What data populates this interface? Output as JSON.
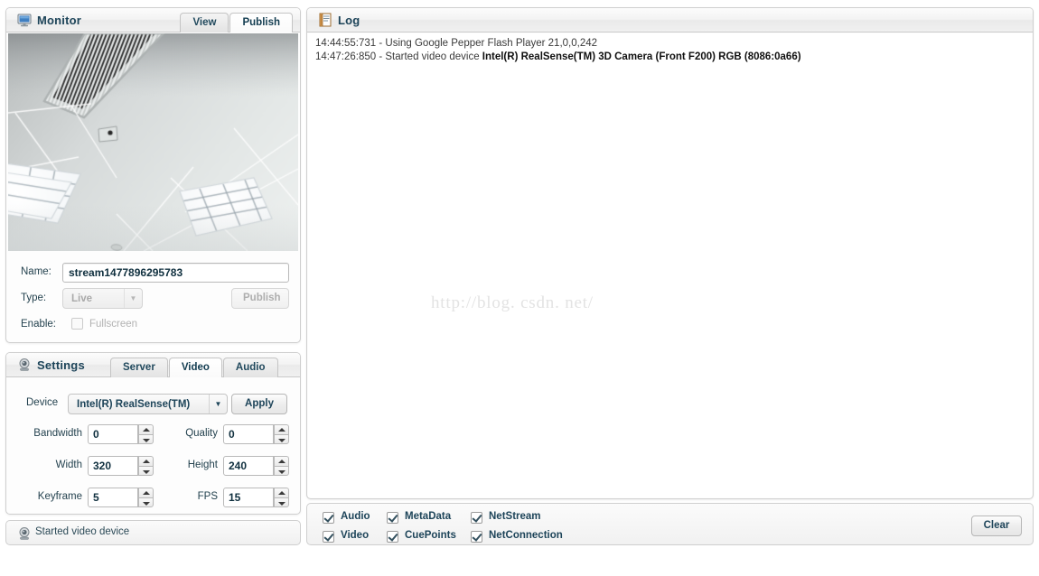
{
  "monitor": {
    "title": "Monitor",
    "icon": "monitor-screen-icon",
    "tabs": [
      {
        "label": "View",
        "active": false
      },
      {
        "label": "Publish",
        "active": true
      }
    ],
    "name_label": "Name:",
    "name_value": "stream1477896295783",
    "type_label": "Type:",
    "type_value": "Live",
    "publish_button": "Publish",
    "enable_label": "Enable:",
    "fullscreen_label": "Fullscreen",
    "fullscreen_checked": false
  },
  "settings": {
    "title": "Settings",
    "icon": "webcam-icon",
    "tabs": [
      {
        "label": "Server",
        "active": false
      },
      {
        "label": "Video",
        "active": true
      },
      {
        "label": "Audio",
        "active": false
      }
    ],
    "device_label": "Device",
    "device_value": "Intel(R) RealSense(TM)",
    "apply_button": "Apply",
    "fields": [
      {
        "label": "Bandwidth",
        "value": "0"
      },
      {
        "label": "Quality",
        "value": "0"
      },
      {
        "label": "Width",
        "value": "320"
      },
      {
        "label": "Height",
        "value": "240"
      },
      {
        "label": "Keyframe",
        "value": "5"
      },
      {
        "label": "FPS",
        "value": "15"
      }
    ]
  },
  "status": {
    "icon": "webcam-icon",
    "text": "Started video device"
  },
  "log": {
    "title": "Log",
    "icon": "notepad-icon",
    "watermark": "http://blog. csdn. net/",
    "lines": [
      {
        "time": "14:44:55:731",
        "sep": " - ",
        "text": "Using Google Pepper Flash Player 21,0,0,242",
        "bold": ""
      },
      {
        "time": "14:47:26:850",
        "sep": " - ",
        "text": "Started video device ",
        "bold": "Intel(R) RealSense(TM) 3D Camera (Front F200) RGB (8086:0a66)"
      }
    ]
  },
  "log_footer": {
    "checkboxes": [
      {
        "label": "Audio",
        "checked": true
      },
      {
        "label": "MetaData",
        "checked": true
      },
      {
        "label": "NetStream",
        "checked": true
      },
      {
        "label": "Video",
        "checked": true
      },
      {
        "label": "CuePoints",
        "checked": true
      },
      {
        "label": "NetConnection",
        "checked": true
      }
    ],
    "clear_button": "Clear"
  },
  "colors": {
    "accent": "#1d4459",
    "panel_border": "#cfcfcf",
    "text": "#24424f"
  }
}
